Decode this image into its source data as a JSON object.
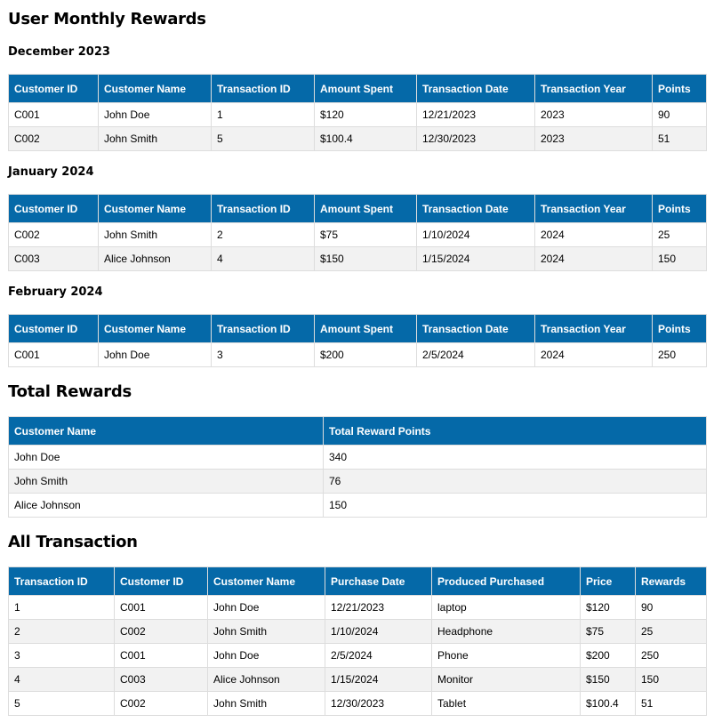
{
  "title": "User Monthly Rewards",
  "monthly_headers": [
    "Customer ID",
    "Customer Name",
    "Transaction ID",
    "Amount Spent",
    "Transaction Date",
    "Transaction Year",
    "Points"
  ],
  "months": [
    {
      "label": "December 2023",
      "rows": [
        [
          "C001",
          "John Doe",
          "1",
          "$120",
          "12/21/2023",
          "2023",
          "90"
        ],
        [
          "C002",
          "John Smith",
          "5",
          "$100.4",
          "12/30/2023",
          "2023",
          "51"
        ]
      ]
    },
    {
      "label": "January 2024",
      "rows": [
        [
          "C002",
          "John Smith",
          "2",
          "$75",
          "1/10/2024",
          "2024",
          "25"
        ],
        [
          "C003",
          "Alice Johnson",
          "4",
          "$150",
          "1/15/2024",
          "2024",
          "150"
        ]
      ]
    },
    {
      "label": "February 2024",
      "rows": [
        [
          "C001",
          "John Doe",
          "3",
          "$200",
          "2/5/2024",
          "2024",
          "250"
        ]
      ]
    }
  ],
  "total": {
    "title": "Total Rewards",
    "headers": [
      "Customer Name",
      "Total Reward Points"
    ],
    "rows": [
      [
        "John Doe",
        "340"
      ],
      [
        "John Smith",
        "76"
      ],
      [
        "Alice Johnson",
        "150"
      ]
    ]
  },
  "all": {
    "title": "All Transaction",
    "headers": [
      "Transaction ID",
      "Customer ID",
      "Customer Name",
      "Purchase Date",
      "Produced Purchased",
      "Price",
      "Rewards"
    ],
    "rows": [
      [
        "1",
        "C001",
        "John Doe",
        "12/21/2023",
        "laptop",
        "$120",
        "90"
      ],
      [
        "2",
        "C002",
        "John Smith",
        "1/10/2024",
        "Headphone",
        "$75",
        "25"
      ],
      [
        "3",
        "C001",
        "John Doe",
        "2/5/2024",
        "Phone",
        "$200",
        "250"
      ],
      [
        "4",
        "C003",
        "Alice Johnson",
        "1/15/2024",
        "Monitor",
        "$150",
        "150"
      ],
      [
        "5",
        "C002",
        "John Smith",
        "12/30/2023",
        "Tablet",
        "$100.4",
        "51"
      ]
    ]
  }
}
